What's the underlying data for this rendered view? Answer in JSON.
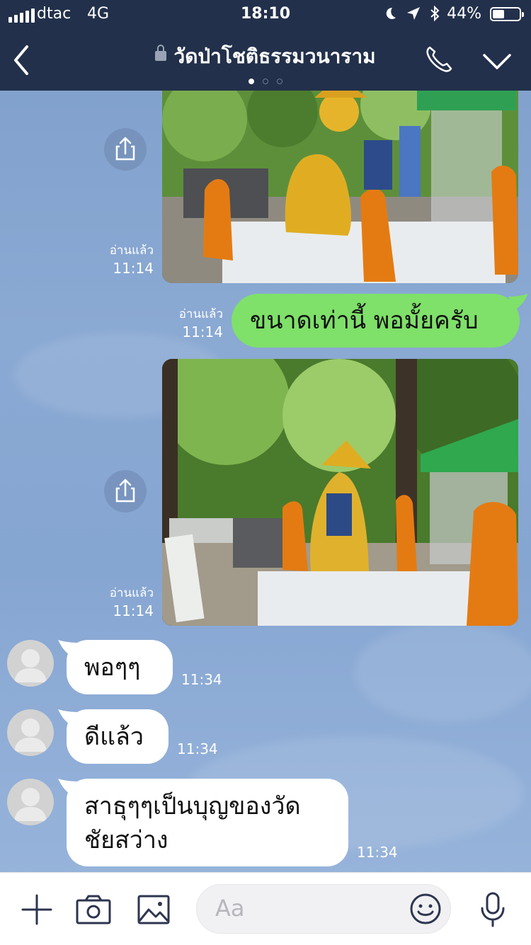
{
  "status_bar": {
    "carrier": "dtac",
    "network": "4G",
    "time": "18:10",
    "battery": "44%",
    "battery_level": 0.44
  },
  "header": {
    "title": "วัดป่าโชติธรรมวนาราม",
    "page_dots": 3,
    "active_dot": 0
  },
  "messages": {
    "photo1": {
      "read": "อ่านแล้ว",
      "time": "11:14"
    },
    "text1": {
      "text": "ขนาดเท่านี้ พอมั้ยครับ",
      "read": "อ่านแล้ว",
      "time": "11:14"
    },
    "photo2": {
      "read": "อ่านแล้ว",
      "time": "11:14"
    },
    "reply1": {
      "text": "พอๆๆ",
      "time": "11:34"
    },
    "reply2": {
      "text": "ดีแล้ว",
      "time": "11:34"
    },
    "reply3": {
      "line1": "สาธุๆๆเป็นบุญของวัด",
      "line2": "ชัยสว่าง",
      "time": "11:34"
    }
  },
  "composer": {
    "placeholder": "Aa"
  },
  "colors": {
    "header_bg": "#22304b",
    "outgoing_bubble": "#7fe06a",
    "incoming_bubble": "#ffffff",
    "chat_bg": "#86a6d2"
  }
}
